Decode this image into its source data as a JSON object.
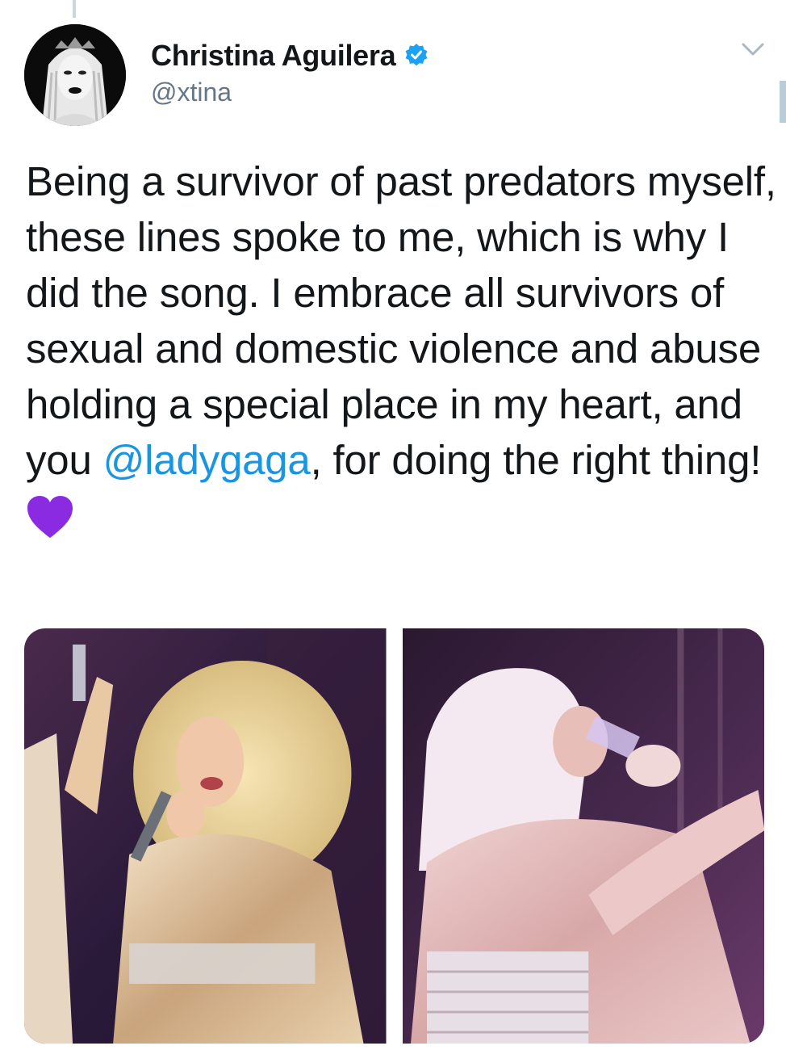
{
  "tweet": {
    "author": {
      "display_name": "Christina Aguilera",
      "handle": "@xtina",
      "verified": true,
      "avatar_icon": "avatar-icon"
    },
    "text_parts": [
      "Being a survivor of past predators myself, these lines spoke to me, which is why I did the song. I embrace all survivors of sexual and domestic violence and abuse holding a special place in my heart, and you ",
      "@ladygaga",
      ", for doing the right thing!"
    ],
    "emoji": "purple-heart-icon",
    "media": [
      {
        "name": "photo-christina-aguilera"
      },
      {
        "name": "photo-lady-gaga"
      }
    ]
  },
  "colors": {
    "text": "#14171a",
    "secondary": "#657786",
    "link": "#1b95e0",
    "verified": "#1da1f2",
    "heart": "#8a2be2"
  }
}
